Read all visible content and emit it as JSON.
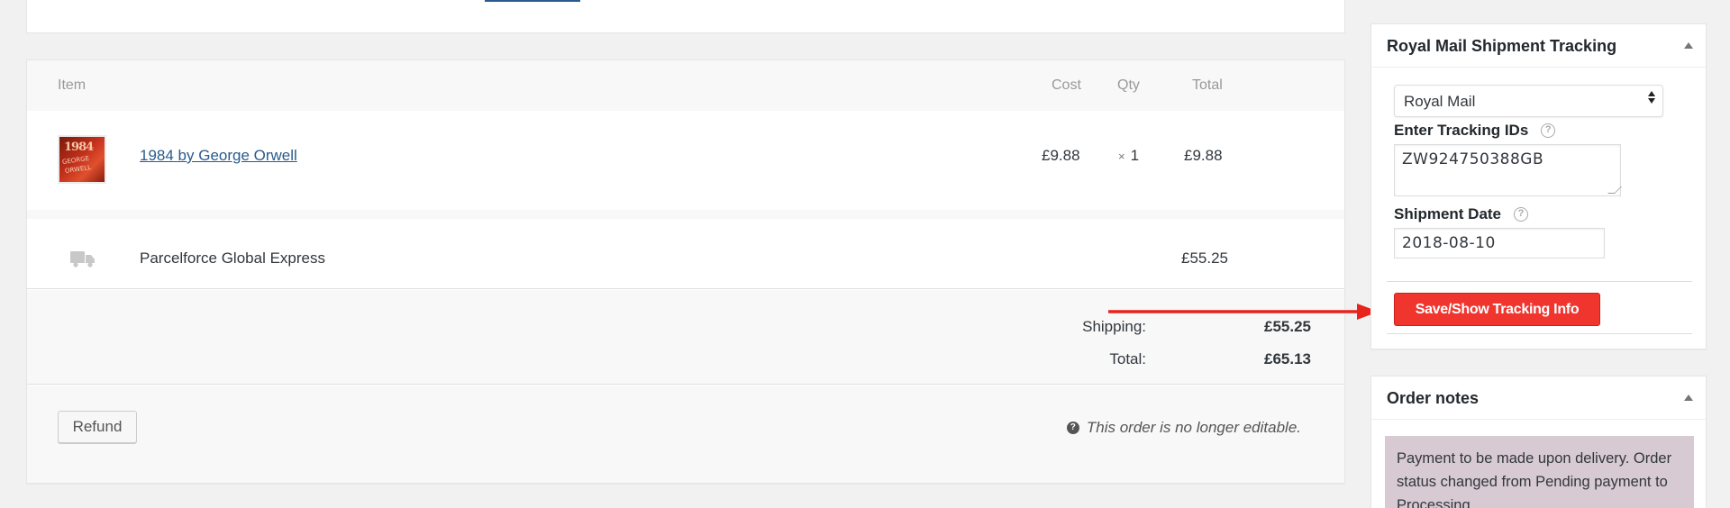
{
  "items_table": {
    "headers": {
      "item": "Item",
      "cost": "Cost",
      "qty": "Qty",
      "total": "Total"
    },
    "line_item": {
      "thumbnail_text": [
        "1984",
        "GEORGE",
        "ORWELL"
      ],
      "name": "1984 by George Orwell",
      "cost": "£9.88",
      "qty_prefix": "×",
      "qty": "1",
      "total": "£9.88"
    },
    "shipping_line": {
      "icon": "truck-icon",
      "name": "Parcelforce Global Express",
      "cost": "£55.25"
    },
    "totals": {
      "shipping_label": "Shipping:",
      "shipping_value": "£55.25",
      "total_label": "Total:",
      "total_value": "£65.13"
    },
    "actions": {
      "refund_label": "Refund",
      "not_editable_text": "This order is no longer editable."
    }
  },
  "tracking_panel": {
    "title": "Royal Mail Shipment Tracking",
    "carrier_selected": "Royal Mail",
    "tracking_label": "Enter Tracking IDs",
    "tracking_value": "ZW924750388GB",
    "date_label": "Shipment Date",
    "date_value": "2018-08-10",
    "save_label": "Save/Show Tracking Info"
  },
  "notes_panel": {
    "title": "Order notes",
    "note_text": "Payment to be made upon delivery. Order status changed from Pending payment to Processing."
  },
  "colors": {
    "accent_red": "#f0352f",
    "link_blue": "#2a5b8c",
    "note_bg": "#d7cad2"
  }
}
